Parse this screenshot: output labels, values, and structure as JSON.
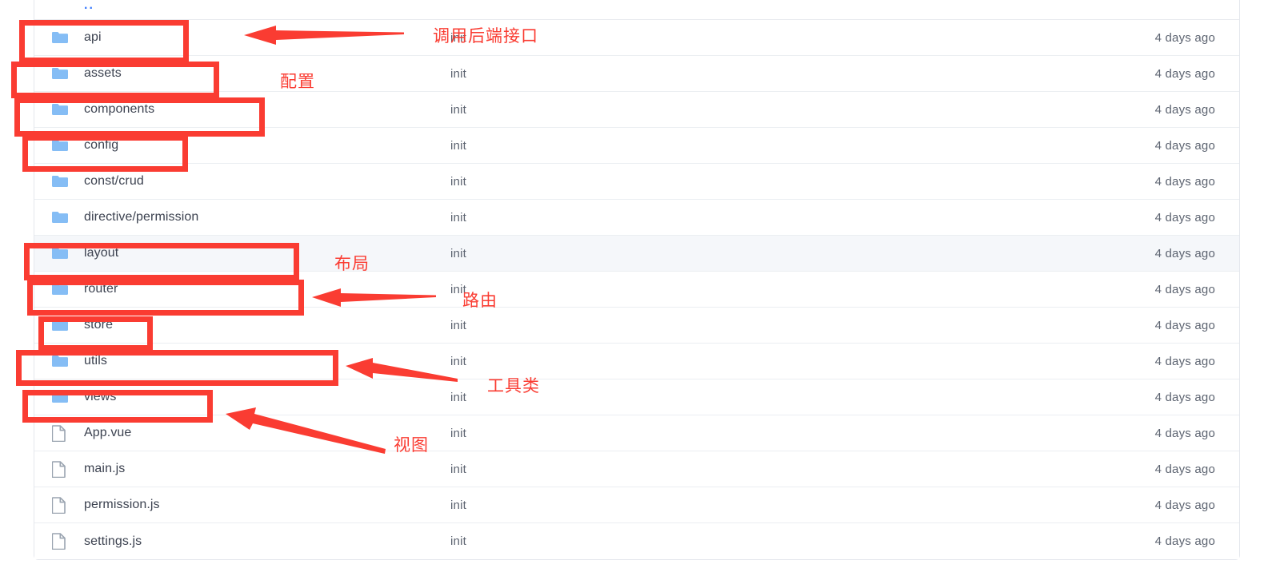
{
  "file_browser": {
    "parent_link": "..",
    "columns": [
      "name",
      "commit_message",
      "updated"
    ],
    "rows": [
      {
        "name": "api",
        "type": "folder",
        "icon": "folder-icon",
        "message": "init",
        "updated": "4 days ago",
        "highlighted": false
      },
      {
        "name": "assets",
        "type": "folder",
        "icon": "folder-icon",
        "message": "init",
        "updated": "4 days ago",
        "highlighted": false
      },
      {
        "name": "components",
        "type": "folder",
        "icon": "folder-icon",
        "message": "init",
        "updated": "4 days ago",
        "highlighted": false
      },
      {
        "name": "config",
        "type": "folder",
        "icon": "folder-icon",
        "message": "init",
        "updated": "4 days ago",
        "highlighted": false
      },
      {
        "name": "const/crud",
        "type": "folder",
        "icon": "folder-icon",
        "message": "init",
        "updated": "4 days ago",
        "highlighted": false
      },
      {
        "name": "directive/permission",
        "type": "folder",
        "icon": "folder-icon",
        "message": "init",
        "updated": "4 days ago",
        "highlighted": false
      },
      {
        "name": "layout",
        "type": "folder",
        "icon": "folder-icon",
        "message": "init",
        "updated": "4 days ago",
        "highlighted": true
      },
      {
        "name": "router",
        "type": "folder",
        "icon": "folder-icon",
        "message": "init",
        "updated": "4 days ago",
        "highlighted": false
      },
      {
        "name": "store",
        "type": "folder",
        "icon": "folder-icon",
        "message": "init",
        "updated": "4 days ago",
        "highlighted": false
      },
      {
        "name": "utils",
        "type": "folder",
        "icon": "folder-icon",
        "message": "init",
        "updated": "4 days ago",
        "highlighted": false
      },
      {
        "name": "views",
        "type": "folder",
        "icon": "folder-icon",
        "message": "init",
        "updated": "4 days ago",
        "highlighted": false
      },
      {
        "name": "App.vue",
        "type": "file",
        "icon": "file-icon",
        "message": "init",
        "updated": "4 days ago",
        "highlighted": false
      },
      {
        "name": "main.js",
        "type": "file",
        "icon": "file-icon",
        "message": "init",
        "updated": "4 days ago",
        "highlighted": false
      },
      {
        "name": "permission.js",
        "type": "file",
        "icon": "file-icon",
        "message": "init",
        "updated": "4 days ago",
        "highlighted": false
      },
      {
        "name": "settings.js",
        "type": "file",
        "icon": "file-icon",
        "message": "init",
        "updated": "4 days ago",
        "highlighted": false
      }
    ]
  },
  "annotations": {
    "accent_color": "#fa3c32",
    "labels": [
      {
        "text": "调用后端接口",
        "target": "api"
      },
      {
        "text": "配置",
        "target": "assets"
      },
      {
        "text": "布局",
        "target": "layout"
      },
      {
        "text": "路由",
        "target": "router"
      },
      {
        "text": "工具类",
        "target": "utils"
      },
      {
        "text": "视图",
        "target": "views"
      }
    ],
    "highlight_boxes": [
      "api",
      "assets",
      "components",
      "config",
      "layout",
      "router",
      "store",
      "utils",
      "views"
    ]
  },
  "colors": {
    "folder_icon": "#85bdf5",
    "file_icon": "#9aa4b0",
    "link_blue": "#3a7afe",
    "text_primary": "#3c4250",
    "text_secondary": "#5c6370",
    "row_highlight": "#f5f7fa",
    "annotation_red": "#fa3c32"
  }
}
